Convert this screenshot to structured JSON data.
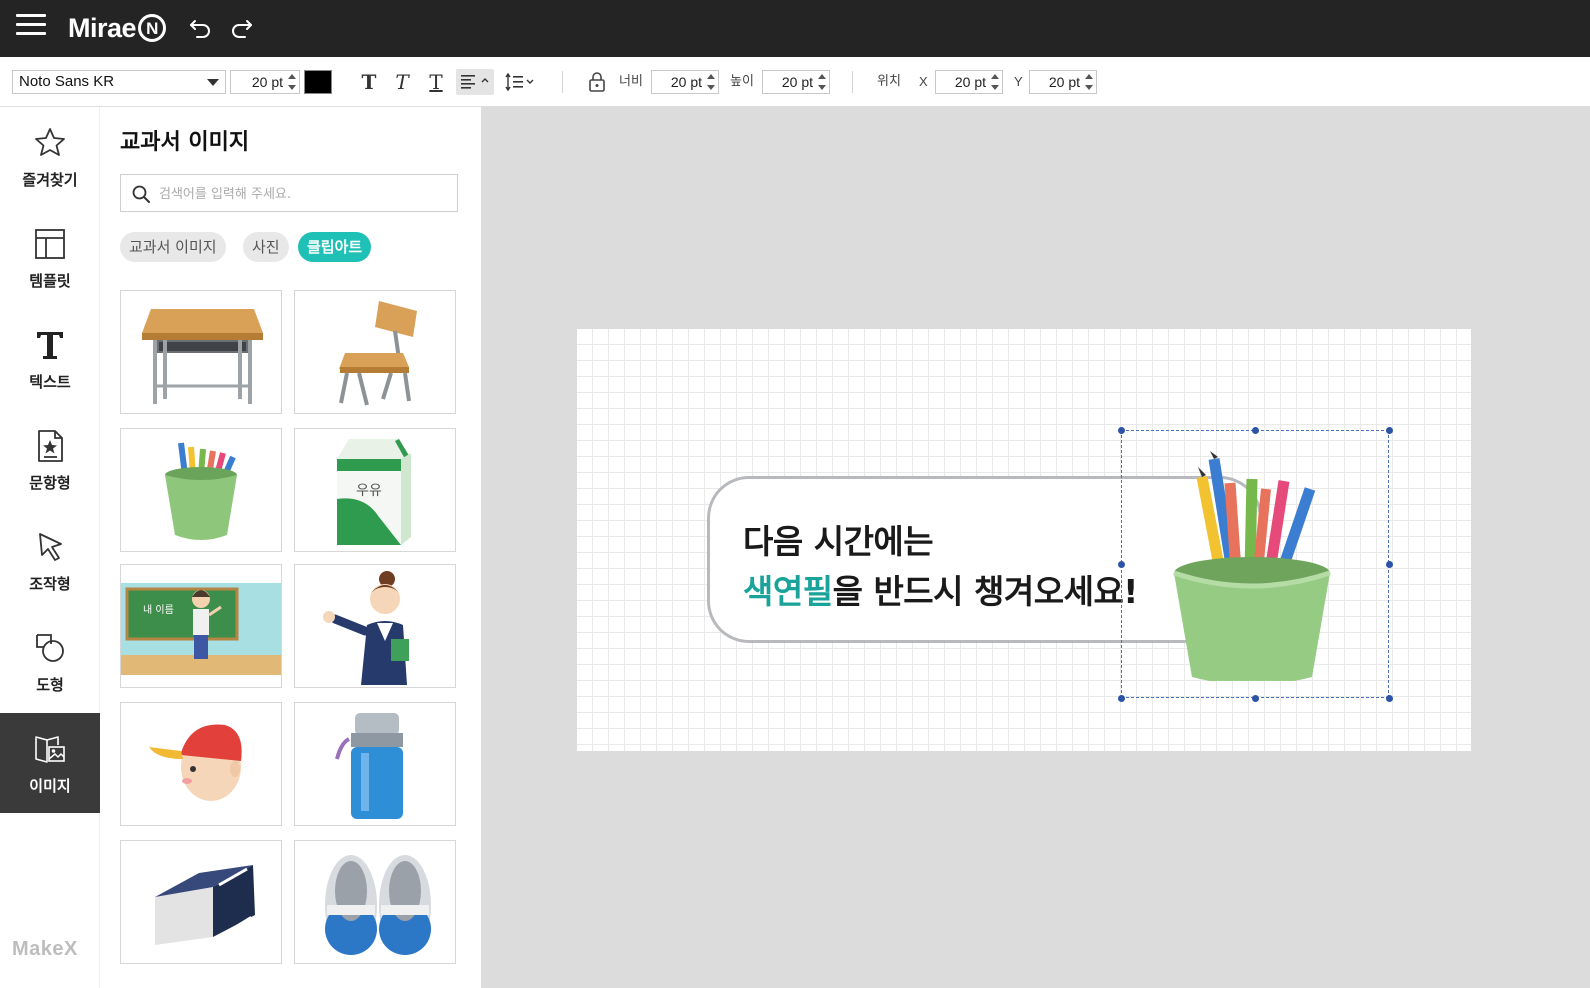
{
  "app": {
    "logo_text": "Mirae",
    "logo_mark": "N",
    "footer_brand": "MakeX"
  },
  "toolbar": {
    "font_family": "Noto Sans KR",
    "font_size": "20 pt",
    "text_color": "#000000",
    "style_buttons": [
      "bold",
      "italic",
      "underline"
    ],
    "labels": {
      "width": "너비",
      "height": "높이",
      "position": "위치",
      "x": "X",
      "y": "Y"
    },
    "width_value": "20 pt",
    "height_value": "20 pt",
    "x_value": "20 pt",
    "y_value": "20 pt"
  },
  "sidebar": {
    "items": [
      {
        "label": "즐겨찾기",
        "icon": "star-icon"
      },
      {
        "label": "템플릿",
        "icon": "template-icon"
      },
      {
        "label": "텍스트",
        "icon": "text-icon"
      },
      {
        "label": "문항형",
        "icon": "question-icon"
      },
      {
        "label": "조작형",
        "icon": "cursor-icon"
      },
      {
        "label": "도형",
        "icon": "shape-icon"
      },
      {
        "label": "이미지",
        "icon": "image-icon",
        "active": true
      }
    ]
  },
  "panel": {
    "title": "교과서 이미지",
    "search_placeholder": "검색어를 입력해 주세요.",
    "filters": [
      {
        "label": "교과서 이미지",
        "active": false
      },
      {
        "label": "사진",
        "active": false
      },
      {
        "label": "클립아트",
        "active": true
      }
    ],
    "images": [
      {
        "name": "desk"
      },
      {
        "name": "chair"
      },
      {
        "name": "pencil-cup"
      },
      {
        "name": "milk-carton",
        "text": "우유"
      },
      {
        "name": "classroom-boy",
        "text": "내 이름"
      },
      {
        "name": "teacher"
      },
      {
        "name": "boy-red-cap"
      },
      {
        "name": "water-bottle"
      },
      {
        "name": "eraser"
      },
      {
        "name": "indoor-shoes"
      }
    ]
  },
  "canvas": {
    "line1": "다음 시간에는",
    "line2_accent": "색연필",
    "line2_rest": "을 반드시 챙겨오세요!",
    "accent_color": "#1aa39a"
  }
}
